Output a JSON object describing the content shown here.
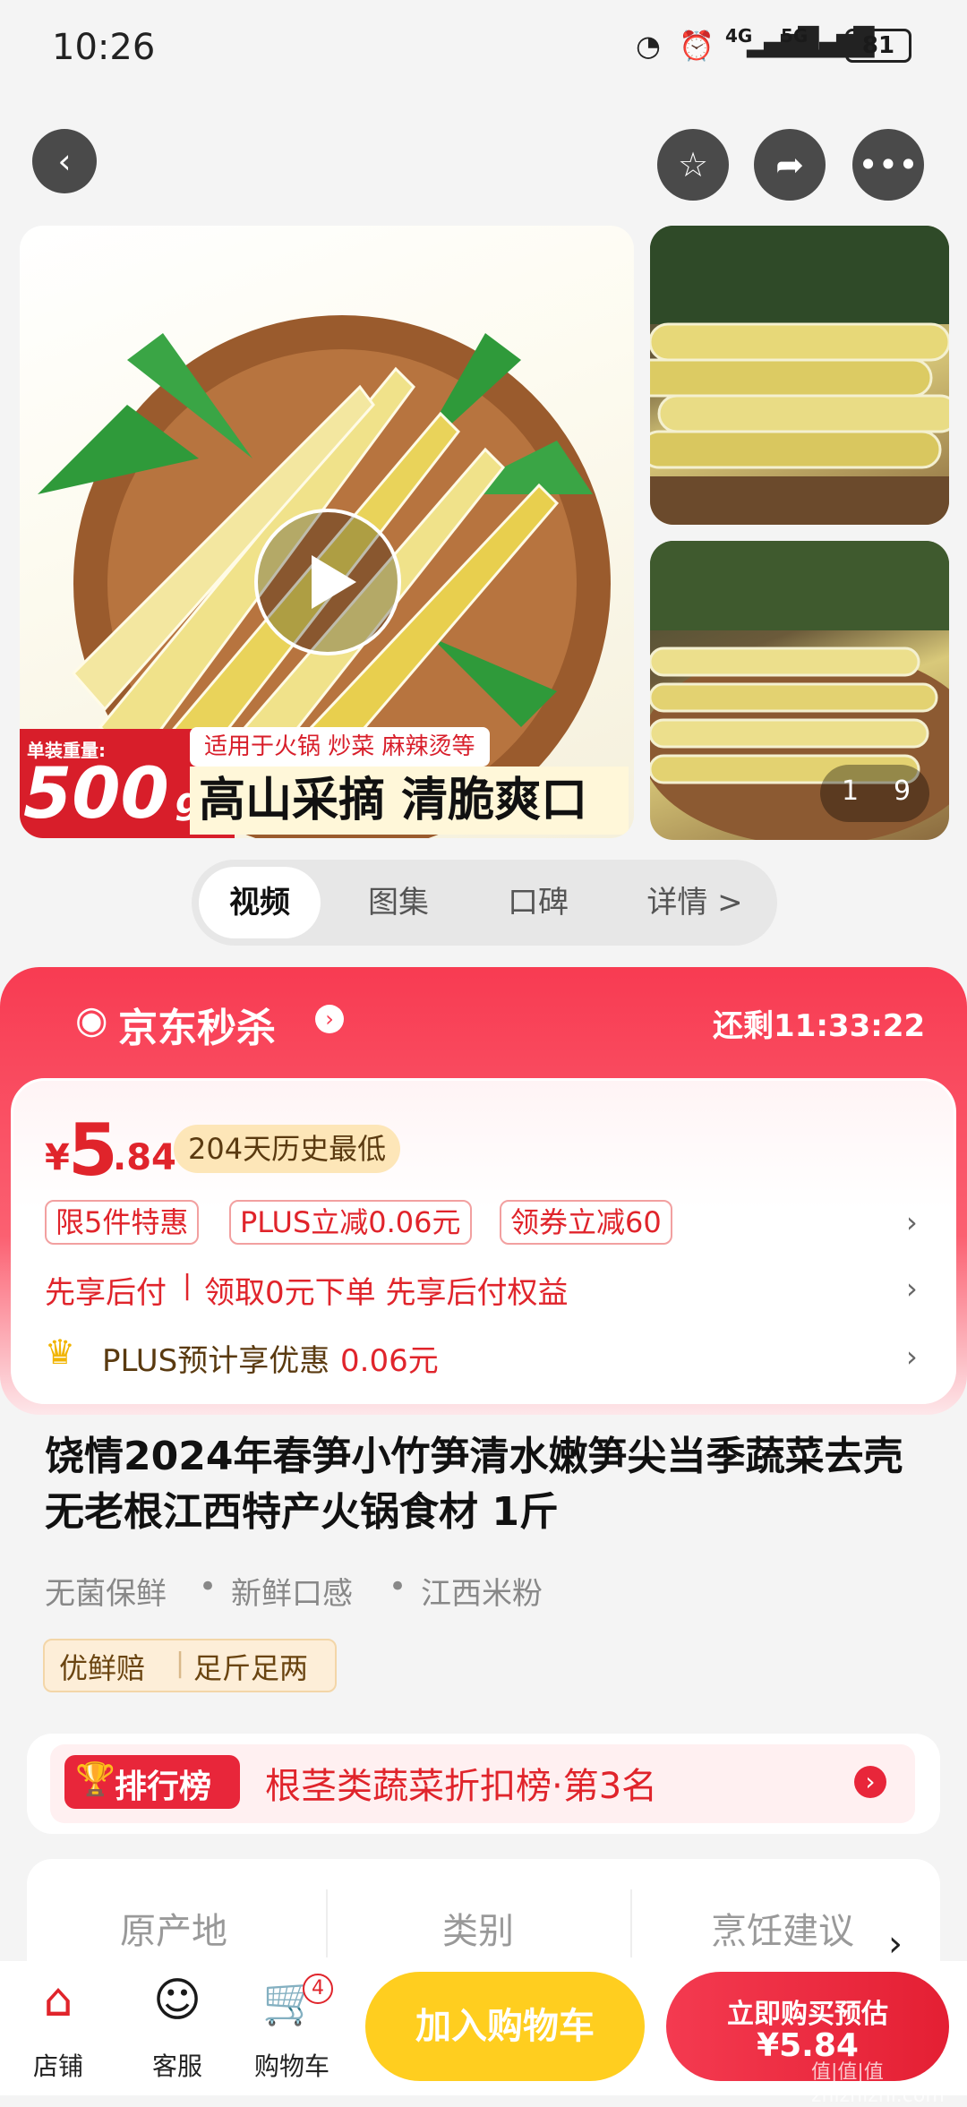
{
  "status_bar": {
    "time": "10:26",
    "network_4g": "4G",
    "network_5g": "5G",
    "battery": "81"
  },
  "gallery": {
    "badge_small": "单装重量:",
    "badge_weight": "500",
    "badge_unit": "g",
    "tagline_small": "适用于火锅 炒菜 麻辣烫等",
    "tagline_big": "高山采摘 清脆爽口",
    "counter_current": "1",
    "counter_total": "9"
  },
  "tabs": [
    "视频",
    "图集",
    "口碑",
    "详情 >"
  ],
  "seckill": {
    "title": "京东秒杀",
    "countdown": "还剩11:33:22",
    "currency": "¥",
    "price_int": "5",
    "price_dec": ".84",
    "history_tag": "204天历史最低",
    "promo_tags": [
      "限5件特惠",
      "PLUS立减0.06元",
      "领券立减60"
    ],
    "pay_later_a": "先享后付",
    "pay_later_b": "领取0元下单 先享后付权益",
    "plus_prefix": "PLUS预计享优惠",
    "plus_value": "0.06元"
  },
  "product": {
    "title": "饶情2024年春笋小竹笋清水嫩笋尖当季蔬菜去壳无老根江西特产火锅食材 1斤",
    "features": [
      "无菌保鲜",
      "新鲜口感",
      "江西米粉"
    ],
    "service_tags": [
      "优鲜赔",
      "足斤足两"
    ]
  },
  "rank": {
    "badge": "排行榜",
    "text": "根茎类蔬菜折扣榜·第3名"
  },
  "attributes": [
    "原产地",
    "类别",
    "烹饪建议"
  ],
  "bottom_bar": {
    "shop": "店铺",
    "service": "客服",
    "cart": "购物车",
    "cart_count": "4",
    "add_cart": "加入购物车",
    "buy_now": "立即购买预估",
    "buy_price": "¥5.84"
  },
  "watermark": "值|值|值 zhizhizhi.com",
  "colors": {
    "brand_red": "#e0242b",
    "seckill_red": "#f83b52",
    "add_cart_yellow": "#ffce1f"
  }
}
